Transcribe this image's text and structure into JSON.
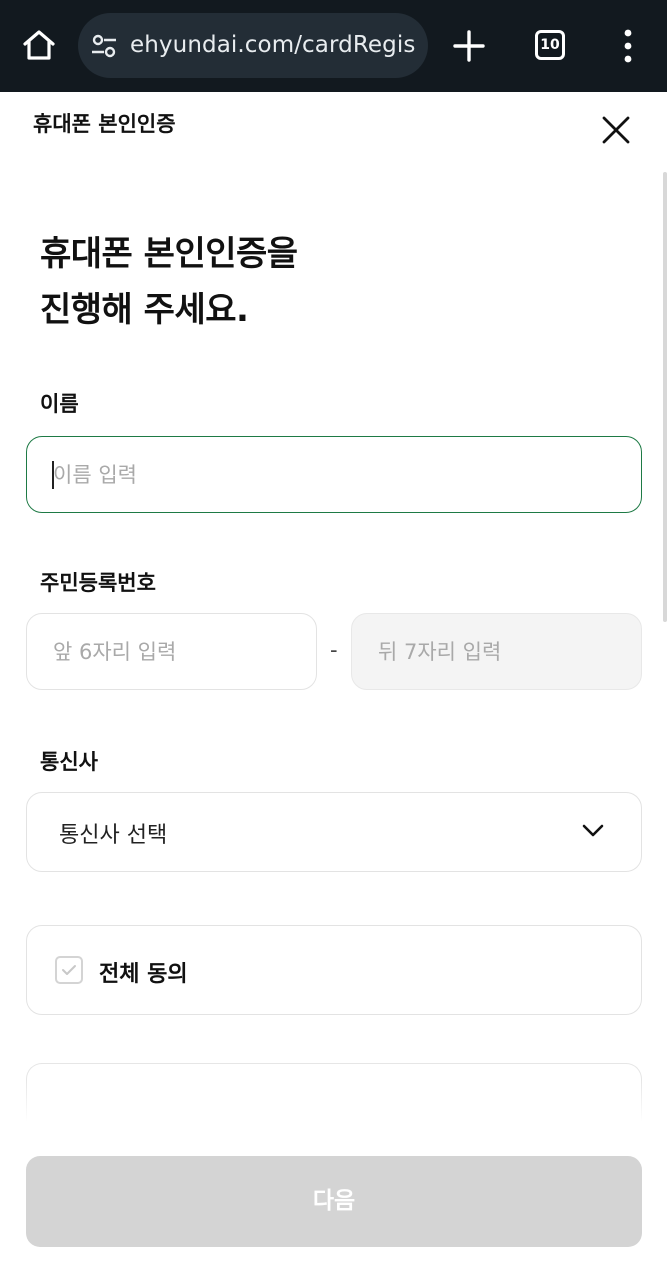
{
  "browser": {
    "url": "ehyundai.com/cardRegis",
    "tab_count": "10",
    "icons": [
      "home-icon",
      "site-settings-icon",
      "plus-icon",
      "tab-switcher-icon",
      "more-vert-icon"
    ]
  },
  "header": {
    "title": "휴대폰 본인인증",
    "close_icon": "close-icon"
  },
  "main": {
    "title_line1": "휴대폰 본인인증을",
    "title_line2": "진행해 주세요."
  },
  "form": {
    "name": {
      "label": "이름",
      "placeholder": "이름 입력",
      "value": ""
    },
    "rrn": {
      "label": "주민등록번호",
      "front_placeholder": "앞 6자리 입력",
      "separator": "-",
      "back_placeholder": "뒤 7자리 입력"
    },
    "carrier": {
      "label": "통신사",
      "selected": "통신사 선택",
      "icon": "chevron-down-icon"
    },
    "agreement": {
      "all_label": "전체 동의",
      "checked": false
    }
  },
  "footer": {
    "next_label": "다음"
  },
  "colors": {
    "browser_bar": "#12191f",
    "focus_border": "#1e7a45",
    "disabled_button": "#d4d4d4"
  }
}
